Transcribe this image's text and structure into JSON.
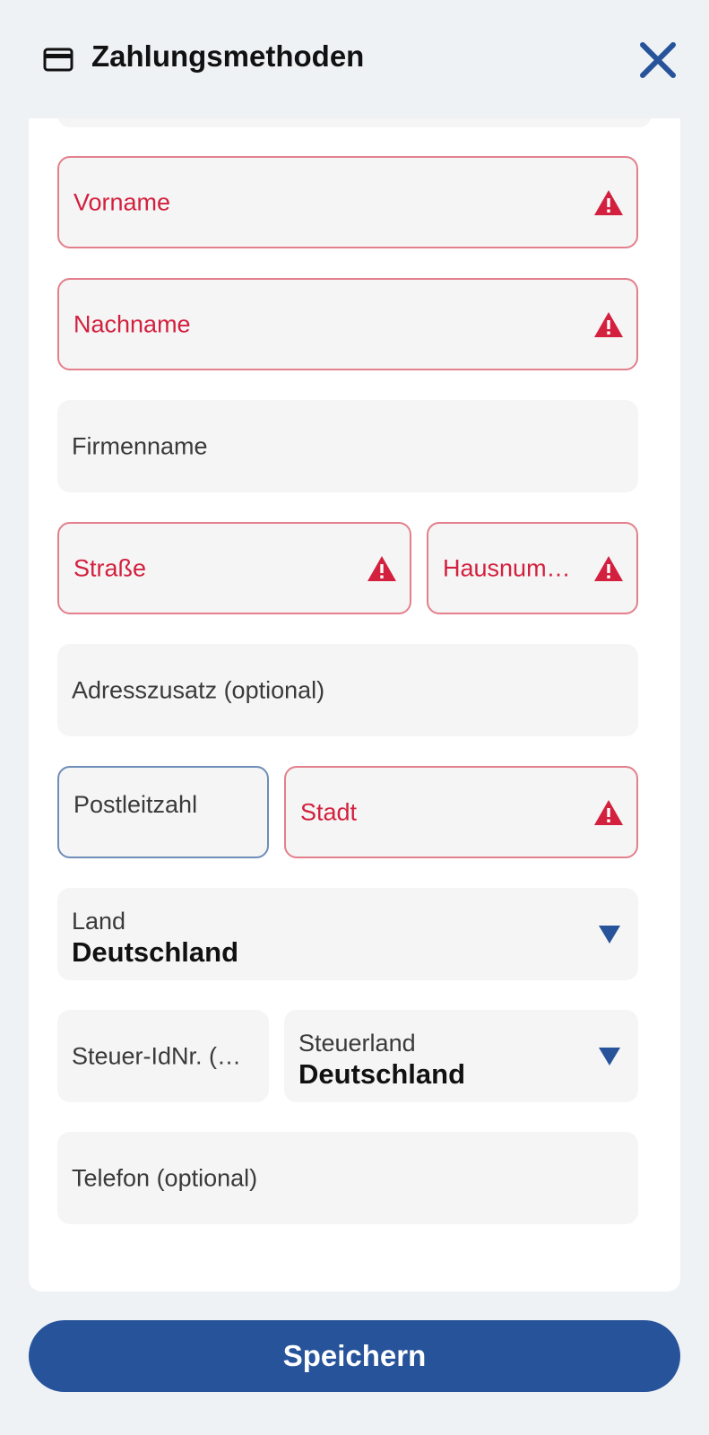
{
  "header": {
    "title": "Zahlungsmethoden",
    "icon": "credit-card-icon",
    "close_icon": "close-icon"
  },
  "form": {
    "first_name": {
      "label": "Vorname",
      "state": "error"
    },
    "last_name": {
      "label": "Nachname",
      "state": "error"
    },
    "company": {
      "label": "Firmenname"
    },
    "street": {
      "label": "Straße",
      "state": "error"
    },
    "house_number": {
      "label": "Hausnum…",
      "state": "error"
    },
    "address_extra": {
      "label": "Adresszusatz (optional)"
    },
    "postal_code": {
      "label": "Postleitzahl",
      "state": "focused"
    },
    "city": {
      "label": "Stadt",
      "state": "error"
    },
    "country": {
      "label": "Land",
      "value": "Deutschland"
    },
    "tax_id": {
      "label": "Steuer-IdNr. (…"
    },
    "tax_country": {
      "label": "Steuerland",
      "value": "Deutschland"
    },
    "phone": {
      "label": "Telefon (optional)"
    }
  },
  "save_button": {
    "label": "Speichern"
  },
  "colors": {
    "accent": "#27539a",
    "error": "#d3203e",
    "error_border": "#e3808c",
    "focus_border": "#6e8db8",
    "field_bg": "#f5f5f5",
    "page_bg": "#eef2f5"
  }
}
